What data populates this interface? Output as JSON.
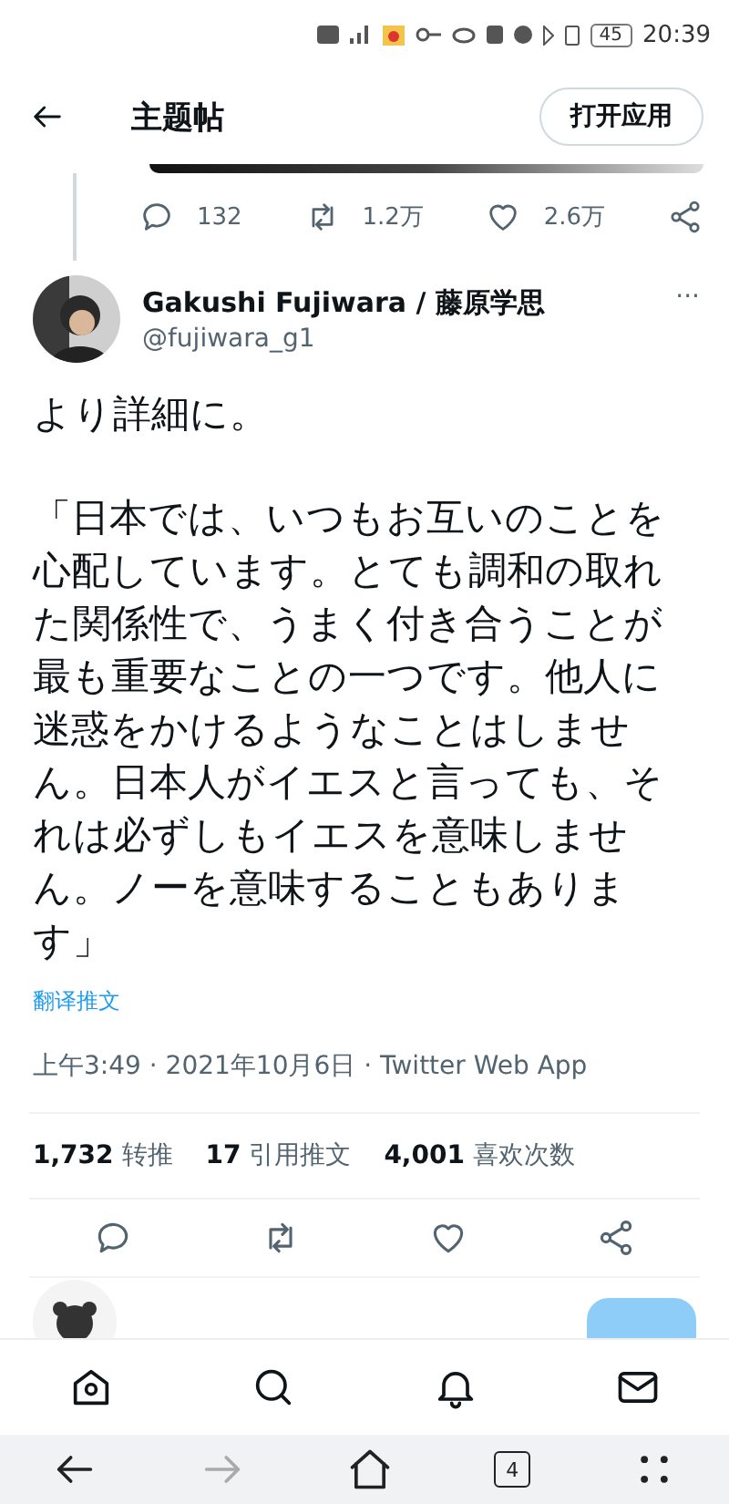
{
  "status_bar": {
    "time": "20:39",
    "battery": "45"
  },
  "header": {
    "title": "主题帖",
    "open_app": "打开应用"
  },
  "previous_tweet_actions": [
    {
      "kind": "reply",
      "count": "132"
    },
    {
      "kind": "retweet",
      "count": "1.2万"
    },
    {
      "kind": "like",
      "count": "2.6万"
    },
    {
      "kind": "share"
    }
  ],
  "tweet": {
    "author_name": "Gakushi Fujiwara / 藤原学思",
    "handle": "@fujiwara_g1",
    "more": "···",
    "paragraphs": [
      "より詳細に。",
      "「日本では、いつもお互いのことを心配しています。とても調和の取れた関係性で、うまく付き合うことが最も重要なことの一つです。他人に迷惑をかけるようなことはしません。日本人がイエスと言っても、それは必ずしもイエスを意味しません。ノーを意味することもあります」"
    ],
    "translate": "翻译推文",
    "timestamp": "上午3:49 · 2021年10月6日 · Twitter Web App",
    "stats": [
      {
        "count": "1,732",
        "label": "转推"
      },
      {
        "count": "17",
        "label": "引用推文"
      },
      {
        "count": "4,001",
        "label": "喜欢次数"
      }
    ],
    "actions": [
      {
        "kind": "reply"
      },
      {
        "kind": "retweet"
      },
      {
        "kind": "like"
      },
      {
        "kind": "share"
      }
    ]
  },
  "bottom_nav": [
    {
      "kind": "home"
    },
    {
      "kind": "search"
    },
    {
      "kind": "bell"
    },
    {
      "kind": "mail"
    }
  ],
  "browser_bar": [
    {
      "kind": "back",
      "disabled": false
    },
    {
      "kind": "forward",
      "disabled": true
    },
    {
      "kind": "home",
      "disabled": false
    },
    {
      "kind": "tabs",
      "count": "4",
      "disabled": false
    },
    {
      "kind": "menu",
      "disabled": false
    }
  ]
}
